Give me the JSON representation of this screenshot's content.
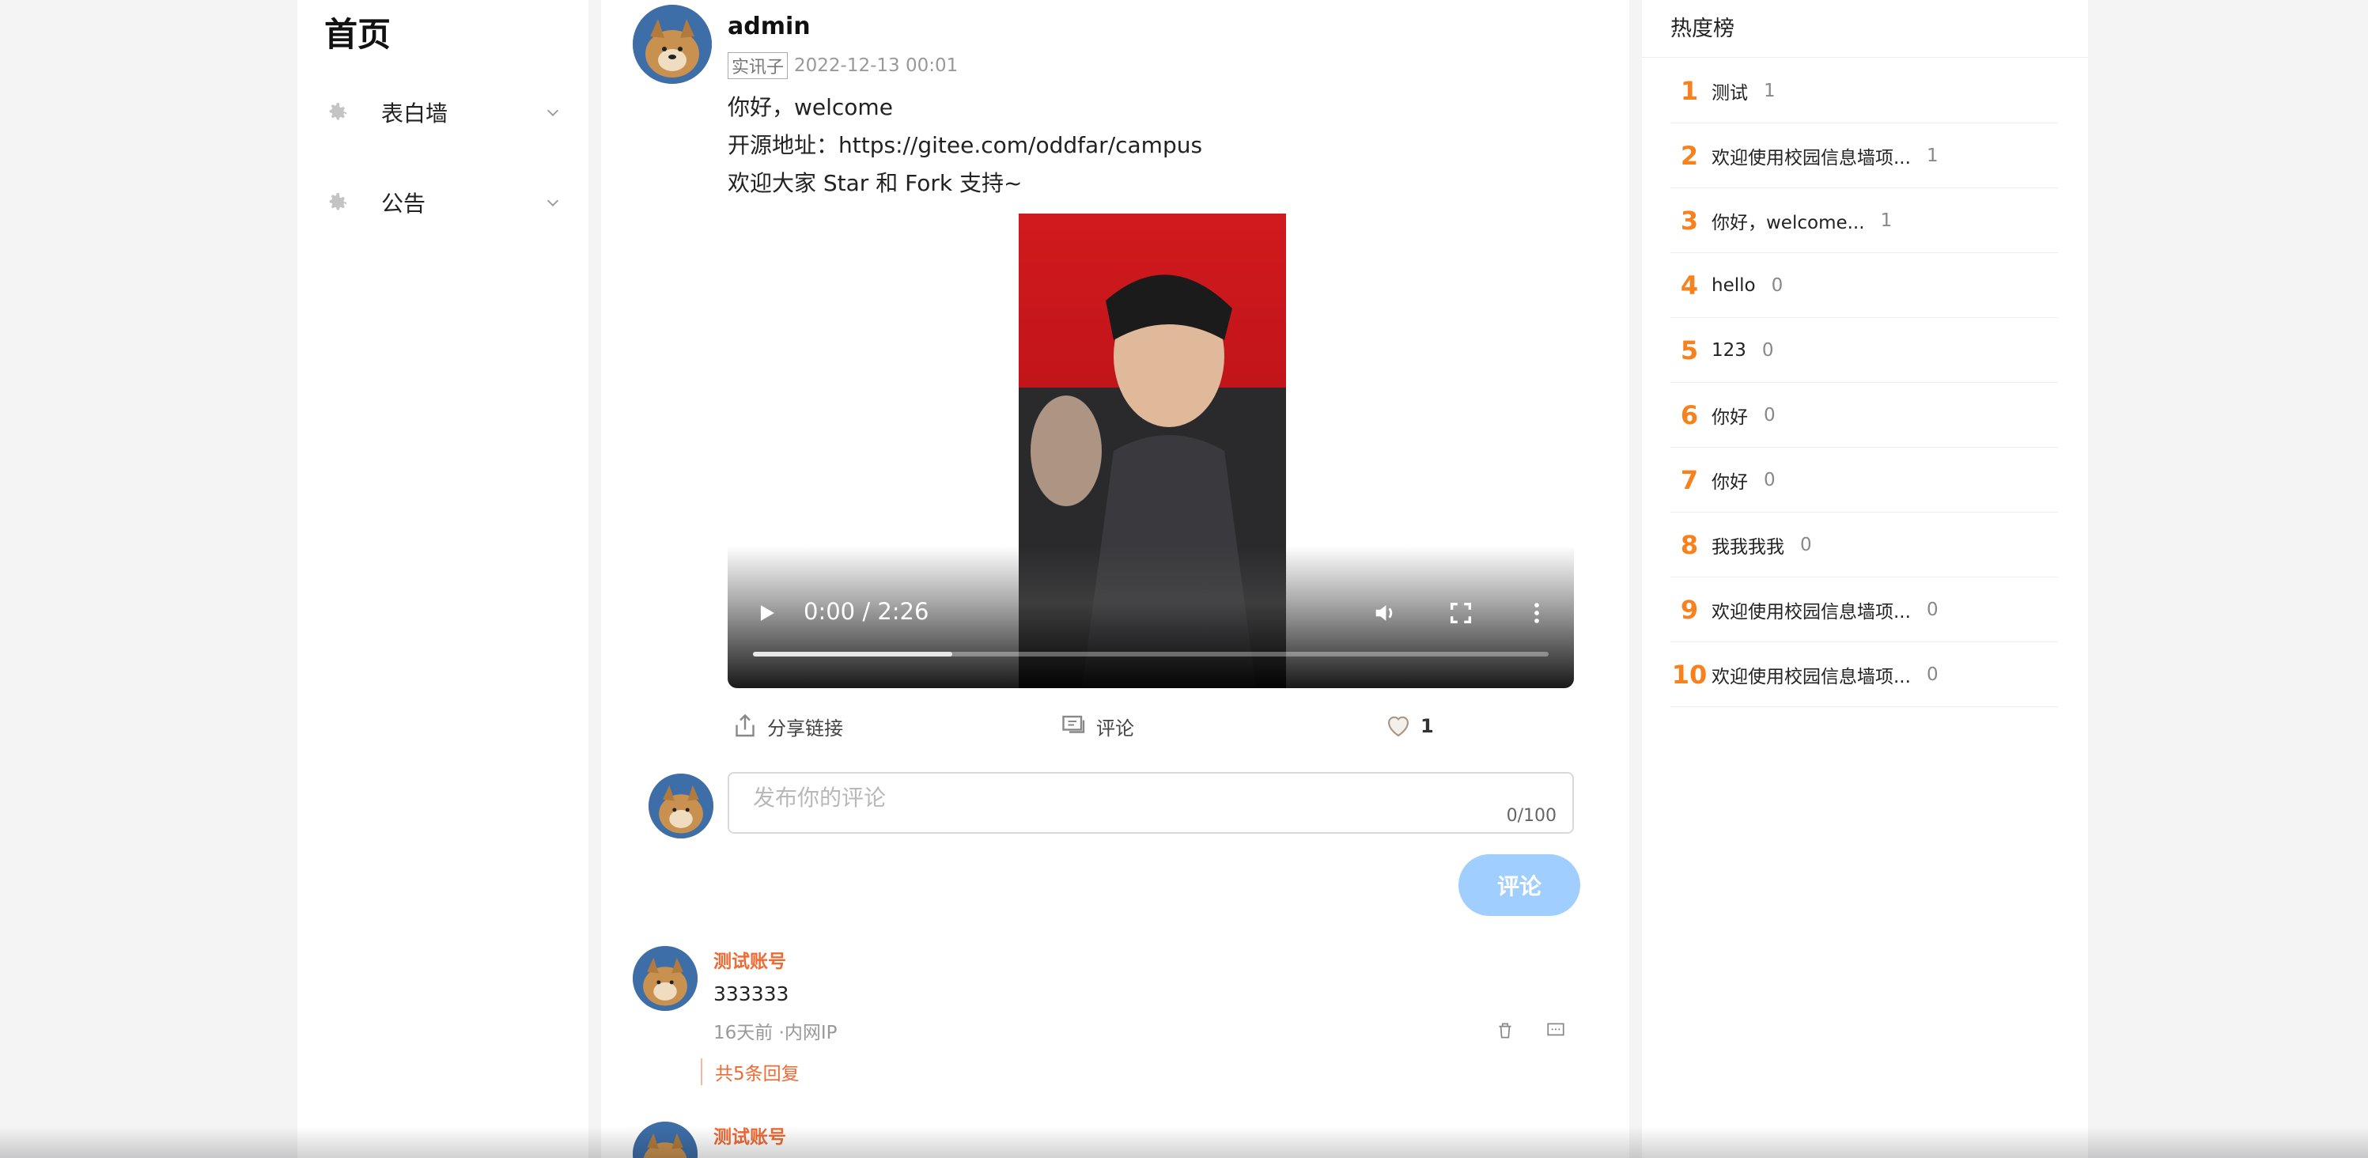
{
  "sidebar": {
    "title": "首页",
    "menu": [
      {
        "label": "表白墙",
        "icon": "gear-icon"
      },
      {
        "label": "公告",
        "icon": "gear-icon"
      }
    ]
  },
  "post": {
    "user": "admin",
    "tag": "实讯子",
    "time": "2022-12-13 00:01",
    "lines": [
      "你好，welcome",
      "开源地址：https://gitee.com/oddfar/campus",
      "欢迎大家 Star 和 Fork 支持~"
    ],
    "video": {
      "time": "0:00 / 2:26",
      "progress": 0.25
    },
    "actions": {
      "share": "分享链接",
      "comment": "评论",
      "likes": "1"
    },
    "comment_input": {
      "placeholder": "发布你的评论",
      "count": "0/100"
    },
    "comment_button": "评论"
  },
  "comments": [
    {
      "user": "测试账号",
      "text": "333333",
      "meta": "16天前 ·内网IP",
      "replies": "共5条回复"
    },
    {
      "user": "测试账号"
    }
  ],
  "hot": {
    "title": "热度榜",
    "items": [
      {
        "rank": "1",
        "name": "测试",
        "count": "1"
      },
      {
        "rank": "2",
        "name": "欢迎使用校园信息墙项...",
        "count": "1"
      },
      {
        "rank": "3",
        "name": "你好，welcome...",
        "count": "1"
      },
      {
        "rank": "4",
        "name": "hello",
        "count": "0"
      },
      {
        "rank": "5",
        "name": "123",
        "count": "0"
      },
      {
        "rank": "6",
        "name": "你好",
        "count": "0"
      },
      {
        "rank": "7",
        "name": "你好",
        "count": "0"
      },
      {
        "rank": "8",
        "name": "我我我我",
        "count": "0"
      },
      {
        "rank": "9",
        "name": "欢迎使用校园信息墙项...",
        "count": "0"
      },
      {
        "rank": "10",
        "name": "欢迎使用校园信息墙项...",
        "count": "0"
      }
    ]
  },
  "colors": {
    "accent": "#f06a34",
    "rank": "#f7811d",
    "button": "#a0cfff"
  }
}
